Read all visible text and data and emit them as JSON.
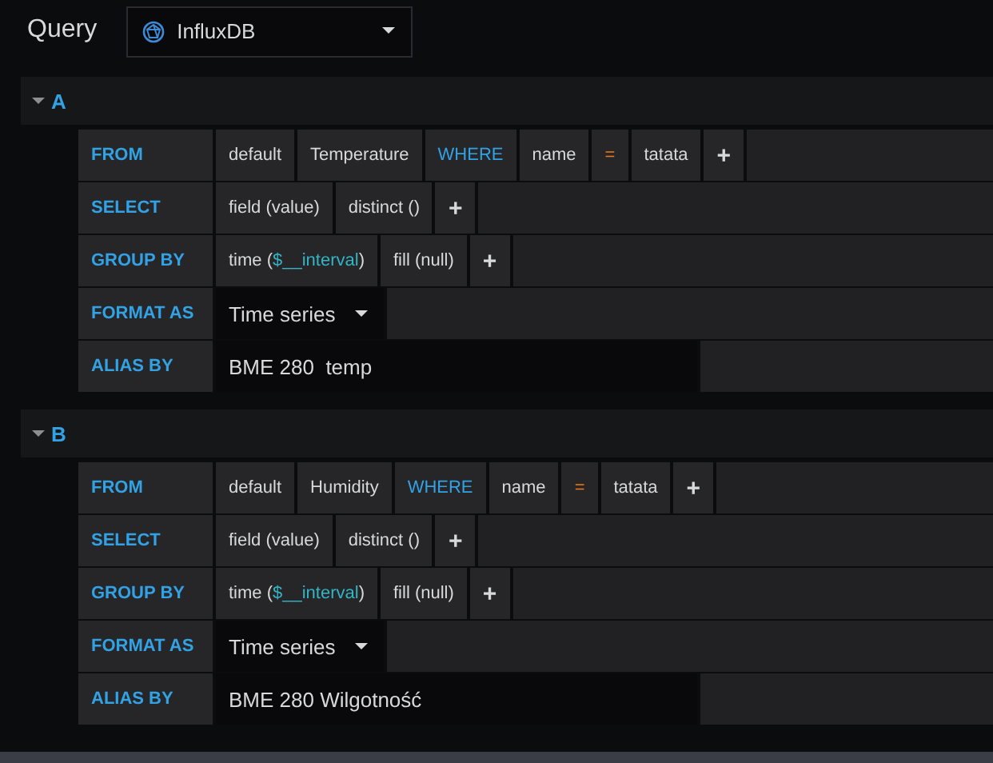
{
  "header": {
    "title": "Query",
    "datasource": "InfluxDB"
  },
  "queries": [
    {
      "letter": "A",
      "expanded": true,
      "rows": [
        {
          "label": "FROM",
          "kind": "segments",
          "segments": [
            {
              "kind": "text",
              "text": "default"
            },
            {
              "kind": "text",
              "text": "Temperature"
            },
            {
              "kind": "keyword",
              "text": "WHERE"
            },
            {
              "kind": "text",
              "text": "name"
            },
            {
              "kind": "operator",
              "text": "="
            },
            {
              "kind": "text",
              "text": "tatata"
            },
            {
              "kind": "plus",
              "text": "+"
            }
          ]
        },
        {
          "label": "SELECT",
          "kind": "segments",
          "segments": [
            {
              "kind": "text",
              "text": "field (value)"
            },
            {
              "kind": "text",
              "text": "distinct ()"
            },
            {
              "kind": "plus",
              "text": "+"
            }
          ]
        },
        {
          "label": "GROUP BY",
          "kind": "segments",
          "segments": [
            {
              "kind": "param",
              "prefix": "time (",
              "param": "$__interval",
              "suffix": ")"
            },
            {
              "kind": "text",
              "text": "fill (null)"
            },
            {
              "kind": "plus",
              "text": "+"
            }
          ]
        },
        {
          "label": "FORMAT AS",
          "kind": "select",
          "value": "Time series"
        },
        {
          "label": "ALIAS BY",
          "kind": "input",
          "value": "BME 280  temp"
        }
      ]
    },
    {
      "letter": "B",
      "expanded": true,
      "rows": [
        {
          "label": "FROM",
          "kind": "segments",
          "segments": [
            {
              "kind": "text",
              "text": "default"
            },
            {
              "kind": "text",
              "text": "Humidity"
            },
            {
              "kind": "keyword",
              "text": "WHERE"
            },
            {
              "kind": "text",
              "text": "name"
            },
            {
              "kind": "operator",
              "text": "="
            },
            {
              "kind": "text",
              "text": "tatata"
            },
            {
              "kind": "plus",
              "text": "+"
            }
          ]
        },
        {
          "label": "SELECT",
          "kind": "segments",
          "segments": [
            {
              "kind": "text",
              "text": "field (value)"
            },
            {
              "kind": "text",
              "text": "distinct ()"
            },
            {
              "kind": "plus",
              "text": "+"
            }
          ]
        },
        {
          "label": "GROUP BY",
          "kind": "segments",
          "segments": [
            {
              "kind": "param",
              "prefix": "time (",
              "param": "$__interval",
              "suffix": ")"
            },
            {
              "kind": "text",
              "text": "fill (null)"
            },
            {
              "kind": "plus",
              "text": "+"
            }
          ]
        },
        {
          "label": "FORMAT AS",
          "kind": "select",
          "value": "Time series"
        },
        {
          "label": "ALIAS BY",
          "kind": "input",
          "value": "BME 280 Wilgotność"
        }
      ]
    }
  ]
}
